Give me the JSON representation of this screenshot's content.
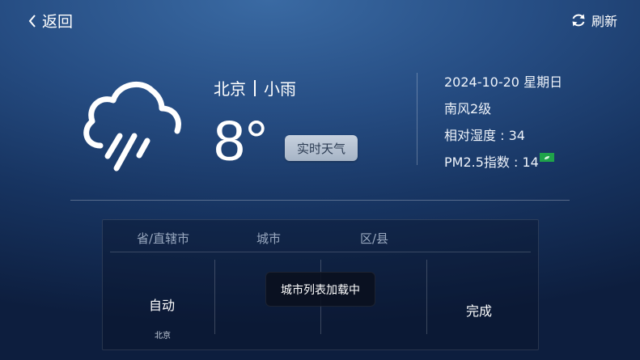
{
  "header": {
    "back_label": "返回",
    "refresh_label": "刷新"
  },
  "weather": {
    "city": "北京",
    "condition": "小雨",
    "temperature": "8°",
    "realtime_label": "实时天气",
    "date": "2024-10-20  星期日",
    "wind": "南风2级",
    "humidity": "相对湿度 : 34",
    "pm25": "PM2.5指数 : 14",
    "pm_badge_color": "#1fa34a",
    "icon": "rain-cloud-icon"
  },
  "picker": {
    "headers": [
      "省/直辖市",
      "城市",
      "区/县"
    ],
    "auto_label": "自动",
    "auto_sub": "北京",
    "done_label": "完成"
  },
  "toast": {
    "message": "城市列表加载中"
  }
}
